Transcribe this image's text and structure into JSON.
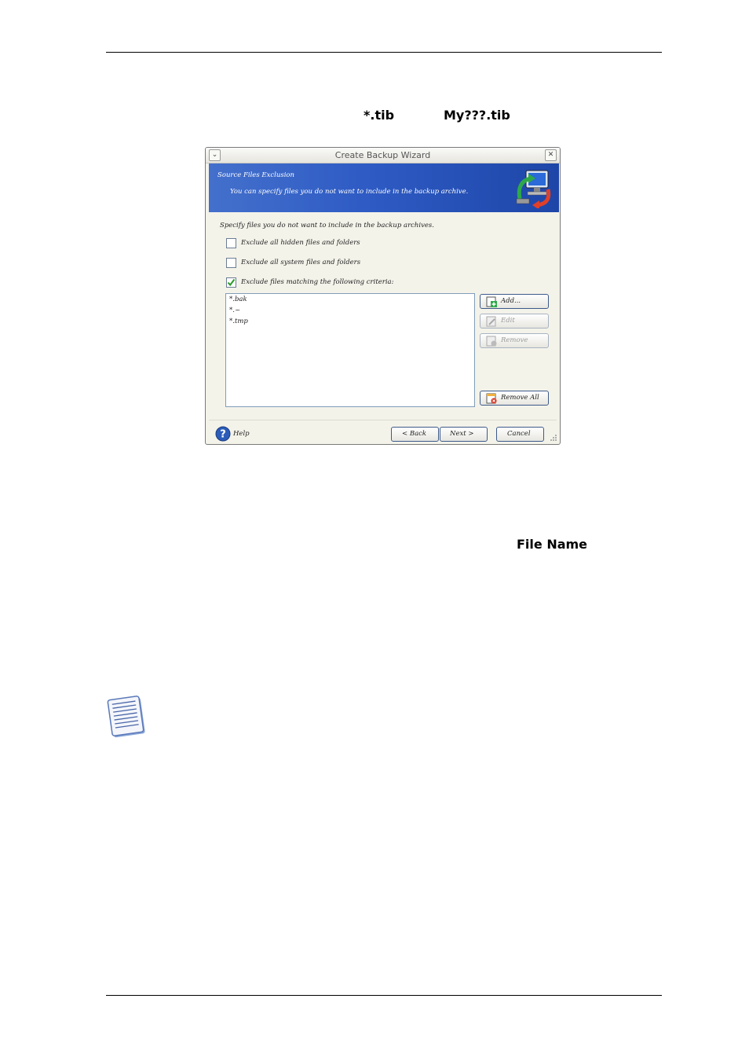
{
  "document": {
    "term_tib": "*.tib",
    "term_mytib": "My???.tib",
    "term_filename": "File Name"
  },
  "dialog": {
    "title": "Create Backup Wizard",
    "banner_title": "Source Files Exclusion",
    "banner_description": "You can specify files you do not want to include in the backup archive.",
    "instruction": "Specify files you do not want to include in the backup archives.",
    "options": [
      {
        "label": "Exclude all hidden files and folders",
        "checked": false
      },
      {
        "label": "Exclude all system files and folders",
        "checked": false
      },
      {
        "label": "Exclude files matching the following criteria:",
        "checked": true
      }
    ],
    "criteria": [
      "*.bak",
      "*.~",
      "*.tmp"
    ],
    "buttons": {
      "add": "Add...",
      "edit": "Edit",
      "remove": "Remove",
      "remove_all": "Remove All"
    },
    "footer": {
      "help": "Help",
      "back": "< Back",
      "next": "Next >",
      "cancel": "Cancel"
    }
  },
  "colors": {
    "banner": "#2e5bc4",
    "check": "#2a9a2a"
  },
  "icons": [
    "computer-backup-icon",
    "add-icon",
    "edit-icon",
    "remove-icon",
    "remove-all-icon",
    "help-icon",
    "note-icon",
    "close-icon",
    "menu-icon"
  ]
}
